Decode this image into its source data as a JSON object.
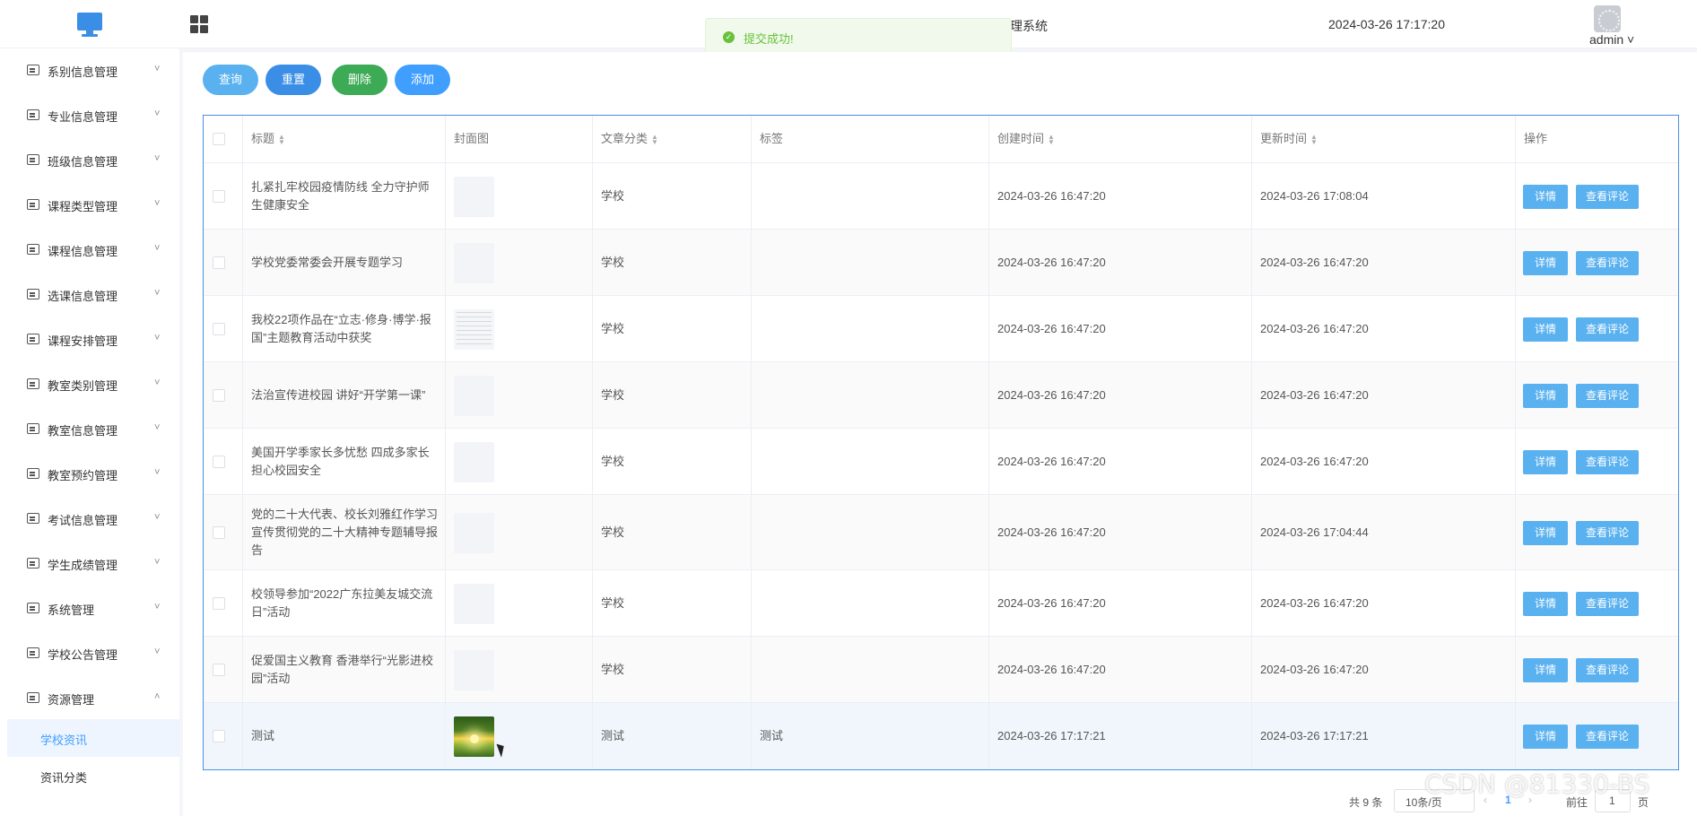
{
  "header": {
    "system_title_partial": "理系统",
    "datetime": "2024-03-26 17:17:20",
    "user": "admin ˅",
    "toast": "提交成功!"
  },
  "sidebar": {
    "items": [
      {
        "label": "系别信息管理",
        "arrow": "˅"
      },
      {
        "label": "专业信息管理",
        "arrow": "˅"
      },
      {
        "label": "班级信息管理",
        "arrow": "˅"
      },
      {
        "label": "课程类型管理",
        "arrow": "˅"
      },
      {
        "label": "课程信息管理",
        "arrow": "˅"
      },
      {
        "label": "选课信息管理",
        "arrow": "˅"
      },
      {
        "label": "课程安排管理",
        "arrow": "˅"
      },
      {
        "label": "教室类别管理",
        "arrow": "˅"
      },
      {
        "label": "教室信息管理",
        "arrow": "˅"
      },
      {
        "label": "教室预约管理",
        "arrow": "˅"
      },
      {
        "label": "考试信息管理",
        "arrow": "˅"
      },
      {
        "label": "学生成绩管理",
        "arrow": "˅"
      },
      {
        "label": "系统管理",
        "arrow": "˅"
      },
      {
        "label": "学校公告管理",
        "arrow": "˅"
      },
      {
        "label": "资源管理",
        "arrow": "˄"
      }
    ],
    "sub_items": [
      {
        "label": "学校资讯",
        "active": true
      },
      {
        "label": "资讯分类",
        "active": false
      }
    ]
  },
  "toolbar": {
    "query_label": "查询",
    "reset_label": "重置",
    "delete_label": "删除",
    "add_label": "添加"
  },
  "table": {
    "columns": {
      "title": "标题",
      "cover": "封面图",
      "category": "文章分类",
      "tags": "标签",
      "created": "创建时间",
      "updated": "更新时间",
      "actions": "操作"
    },
    "detail_label": "详情",
    "comment_label": "查看评论",
    "rows": [
      {
        "title": "扎紧扎牢校园疫情防线 全力守护师生健康安全",
        "cover": "blank",
        "category": "学校",
        "tags": "",
        "created": "2024-03-26 16:47:20",
        "updated": "2024-03-26 17:08:04"
      },
      {
        "title": "学校党委常委会开展专题学习",
        "cover": "blank",
        "category": "学校",
        "tags": "",
        "created": "2024-03-26 16:47:20",
        "updated": "2024-03-26 16:47:20"
      },
      {
        "title": "我校22项作品在“立志·修身·博学·报国”主题教育活动中获奖",
        "cover": "doc",
        "category": "学校",
        "tags": "",
        "created": "2024-03-26 16:47:20",
        "updated": "2024-03-26 16:47:20"
      },
      {
        "title": "法治宣传进校园 讲好“开学第一课”",
        "cover": "blank",
        "category": "学校",
        "tags": "",
        "created": "2024-03-26 16:47:20",
        "updated": "2024-03-26 16:47:20"
      },
      {
        "title": "美国开学季家长多忧愁 四成多家长担心校园安全",
        "cover": "blank",
        "category": "学校",
        "tags": "",
        "created": "2024-03-26 16:47:20",
        "updated": "2024-03-26 16:47:20"
      },
      {
        "title": "党的二十大代表、校长刘雅红作学习宣传贯彻党的二十大精神专题辅导报告",
        "cover": "blank",
        "category": "学校",
        "tags": "",
        "created": "2024-03-26 16:47:20",
        "updated": "2024-03-26 17:04:44"
      },
      {
        "title": "校领导参加“2022广东拉美友城交流日”活动",
        "cover": "blank",
        "category": "学校",
        "tags": "",
        "created": "2024-03-26 16:47:20",
        "updated": "2024-03-26 16:47:20"
      },
      {
        "title": "促爱国主义教育 香港举行“光影进校园”活动",
        "cover": "blank",
        "category": "学校",
        "tags": "",
        "created": "2024-03-26 16:47:20",
        "updated": "2024-03-26 16:47:20"
      },
      {
        "title": "测试",
        "cover": "photo",
        "category": "测试",
        "tags": "测试",
        "created": "2024-03-26 17:17:21",
        "updated": "2024-03-26 17:17:21"
      }
    ]
  },
  "pagination": {
    "total": "共 9 条",
    "page_size": "10条/页",
    "prev": "‹",
    "current_page": "1",
    "next": "›",
    "goto": "前往",
    "goto_value": "1",
    "page_unit": "页"
  },
  "watermark": "CSDN @81330-BS"
}
